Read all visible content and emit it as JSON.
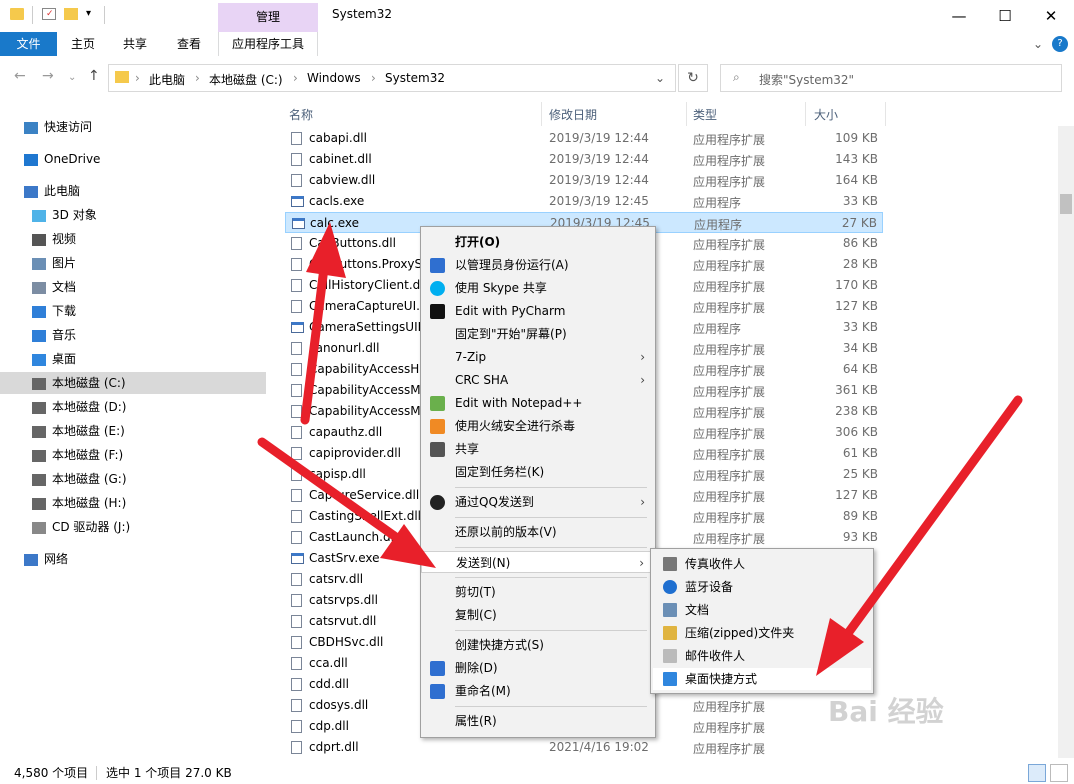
{
  "titlebar": {
    "context_tab": "管理",
    "window_title": "System32",
    "minimize": "—",
    "maximize": "☐",
    "close": "✕"
  },
  "ribbon": {
    "tabs": [
      "文件",
      "主页",
      "共享",
      "查看",
      "应用程序工具"
    ],
    "collapse": "⌄",
    "help": "?"
  },
  "address": {
    "crumbs": [
      "此电脑",
      "本地磁盘 (C:)",
      "Windows",
      "System32"
    ],
    "search_placeholder": "搜索\"System32\""
  },
  "sidebar": {
    "items": [
      {
        "label": "快速访问",
        "icon": "star-icon"
      },
      {
        "label": "OneDrive",
        "icon": "cloud-icon"
      },
      {
        "label": "此电脑",
        "icon": "computer-icon"
      },
      {
        "label": "3D 对象",
        "icon": "3d-objects-icon"
      },
      {
        "label": "视频",
        "icon": "video-icon"
      },
      {
        "label": "图片",
        "icon": "picture-icon"
      },
      {
        "label": "文档",
        "icon": "document-icon"
      },
      {
        "label": "下载",
        "icon": "download-icon"
      },
      {
        "label": "音乐",
        "icon": "music-icon"
      },
      {
        "label": "桌面",
        "icon": "desktop-icon"
      },
      {
        "label": "本地磁盘 (C:)",
        "icon": "drive-icon"
      },
      {
        "label": "本地磁盘 (D:)",
        "icon": "drive-icon"
      },
      {
        "label": "本地磁盘 (E:)",
        "icon": "drive-icon"
      },
      {
        "label": "本地磁盘 (F:)",
        "icon": "drive-icon"
      },
      {
        "label": "本地磁盘 (G:)",
        "icon": "drive-icon"
      },
      {
        "label": "本地磁盘 (H:)",
        "icon": "drive-icon"
      },
      {
        "label": "CD 驱动器 (J:)",
        "icon": "cd-drive-icon"
      },
      {
        "label": "网络",
        "icon": "network-icon"
      }
    ]
  },
  "columns": [
    "名称",
    "修改日期",
    "类型",
    "大小"
  ],
  "files": [
    {
      "name": "cabapi.dll",
      "date": "2019/3/19 12:44",
      "type": "应用程序扩展",
      "size": "109 KB"
    },
    {
      "name": "cabinet.dll",
      "date": "2019/3/19 12:44",
      "type": "应用程序扩展",
      "size": "143 KB"
    },
    {
      "name": "cabview.dll",
      "date": "2019/3/19 12:44",
      "type": "应用程序扩展",
      "size": "164 KB"
    },
    {
      "name": "cacls.exe",
      "date": "2019/3/19 12:45",
      "type": "应用程序",
      "size": "33 KB"
    },
    {
      "name": "calc.exe",
      "date": "2019/3/19 12:45",
      "type": "应用程序",
      "size": "27 KB"
    },
    {
      "name": "CallButtons.dll",
      "date": "",
      "type": "应用程序扩展",
      "size": "86 KB"
    },
    {
      "name": "CallButtons.ProxyStub.dll",
      "date": "",
      "type": "应用程序扩展",
      "size": "28 KB"
    },
    {
      "name": "CallHistoryClient.dll",
      "date": "",
      "type": "应用程序扩展",
      "size": "170 KB"
    },
    {
      "name": "CameraCaptureUI.dll",
      "date": "",
      "type": "应用程序扩展",
      "size": "127 KB"
    },
    {
      "name": "CameraSettingsUIHost.exe",
      "date": "",
      "type": "应用程序",
      "size": "33 KB"
    },
    {
      "name": "canonurl.dll",
      "date": "",
      "type": "应用程序扩展",
      "size": "34 KB"
    },
    {
      "name": "CapabilityAccessHandlers.dll",
      "date": "",
      "type": "应用程序扩展",
      "size": "64 KB"
    },
    {
      "name": "CapabilityAccessManager.dll",
      "date": "",
      "type": "应用程序扩展",
      "size": "361 KB"
    },
    {
      "name": "CapabilityAccessManagerClient.dll",
      "date": "",
      "type": "应用程序扩展",
      "size": "238 KB"
    },
    {
      "name": "capauthz.dll",
      "date": "",
      "type": "应用程序扩展",
      "size": "306 KB"
    },
    {
      "name": "capiprovider.dll",
      "date": "",
      "type": "应用程序扩展",
      "size": "61 KB"
    },
    {
      "name": "capisp.dll",
      "date": "",
      "type": "应用程序扩展",
      "size": "25 KB"
    },
    {
      "name": "CaptureService.dll",
      "date": "",
      "type": "应用程序扩展",
      "size": "127 KB"
    },
    {
      "name": "CastingShellExt.dll",
      "date": "",
      "type": "应用程序扩展",
      "size": "89 KB"
    },
    {
      "name": "CastLaunch.dll",
      "date": "",
      "type": "应用程序扩展",
      "size": "93 KB"
    },
    {
      "name": "CastSrv.exe",
      "date": "",
      "type": "应用程序",
      "size": ""
    },
    {
      "name": "catsrv.dll",
      "date": "",
      "type": "应用程序扩展",
      "size": ""
    },
    {
      "name": "catsrvps.dll",
      "date": "",
      "type": "应用程序扩展",
      "size": ""
    },
    {
      "name": "catsrvut.dll",
      "date": "",
      "type": "应用程序扩展",
      "size": ""
    },
    {
      "name": "CBDHSvc.dll",
      "date": "",
      "type": "应用程序扩展",
      "size": ""
    },
    {
      "name": "cca.dll",
      "date": "",
      "type": "应用程序扩展",
      "size": ""
    },
    {
      "name": "cdd.dll",
      "date": "",
      "type": "应用程序扩展",
      "size": ""
    },
    {
      "name": "cdosys.dll",
      "date": "",
      "type": "应用程序扩展",
      "size": ""
    },
    {
      "name": "cdp.dll",
      "date": "",
      "type": "应用程序扩展",
      "size": ""
    },
    {
      "name": "cdprt.dll",
      "date": "2021/4/16 19:02",
      "type": "应用程序扩展",
      "size": ""
    }
  ],
  "status": {
    "count": "4,580 个项目",
    "selection": "选中 1 个项目  27.0 KB"
  },
  "context_menu": {
    "items": [
      {
        "label": "打开(O)",
        "bold": true,
        "icon": "",
        "arrow": false
      },
      {
        "label": "以管理员身份运行(A)",
        "icon": "shield-icon",
        "arrow": false
      },
      {
        "label": "使用 Skype 共享",
        "icon": "skype-icon",
        "arrow": false
      },
      {
        "label": "Edit with PyCharm",
        "icon": "pycharm-icon",
        "arrow": false
      },
      {
        "label": "固定到\"开始\"屏幕(P)",
        "icon": "",
        "arrow": false
      },
      {
        "label": "7-Zip",
        "icon": "",
        "arrow": true
      },
      {
        "label": "CRC SHA",
        "icon": "",
        "arrow": true
      },
      {
        "label": "Edit with Notepad++",
        "icon": "notepad-icon",
        "arrow": false
      },
      {
        "label": "使用火绒安全进行杀毒",
        "icon": "huorong-icon",
        "arrow": false
      },
      {
        "label": "共享",
        "icon": "share-icon",
        "arrow": false
      },
      {
        "label": "固定到任务栏(K)",
        "icon": "",
        "arrow": false
      },
      {
        "label": "通过QQ发送到",
        "icon": "qq-icon",
        "arrow": true
      },
      {
        "label": "还原以前的版本(V)",
        "icon": "",
        "arrow": false
      },
      {
        "label": "发送到(N)",
        "icon": "",
        "arrow": true
      },
      {
        "label": "剪切(T)",
        "icon": "",
        "arrow": false
      },
      {
        "label": "复制(C)",
        "icon": "",
        "arrow": false
      },
      {
        "label": "创建快捷方式(S)",
        "icon": "",
        "arrow": false
      },
      {
        "label": "删除(D)",
        "icon": "shield-icon",
        "arrow": false
      },
      {
        "label": "重命名(M)",
        "icon": "shield-icon",
        "arrow": false
      },
      {
        "label": "属性(R)",
        "icon": "",
        "arrow": false
      }
    ],
    "arrow_glyph": "›"
  },
  "sendto_menu": {
    "items": [
      {
        "label": "传真收件人",
        "icon": "fax-icon"
      },
      {
        "label": "蓝牙设备",
        "icon": "bluetooth-icon"
      },
      {
        "label": "文档",
        "icon": "document-icon"
      },
      {
        "label": "压缩(zipped)文件夹",
        "icon": "zip-folder-icon"
      },
      {
        "label": "邮件收件人",
        "icon": "mail-icon"
      },
      {
        "label": "桌面快捷方式",
        "icon": "desktop-icon"
      }
    ]
  },
  "watermark": "Bai 经验",
  "colors": {
    "accent": "#1979ca",
    "selection": "#cce8ff",
    "arrow": "#e8202a",
    "context_tab": "#e8d4f5"
  }
}
